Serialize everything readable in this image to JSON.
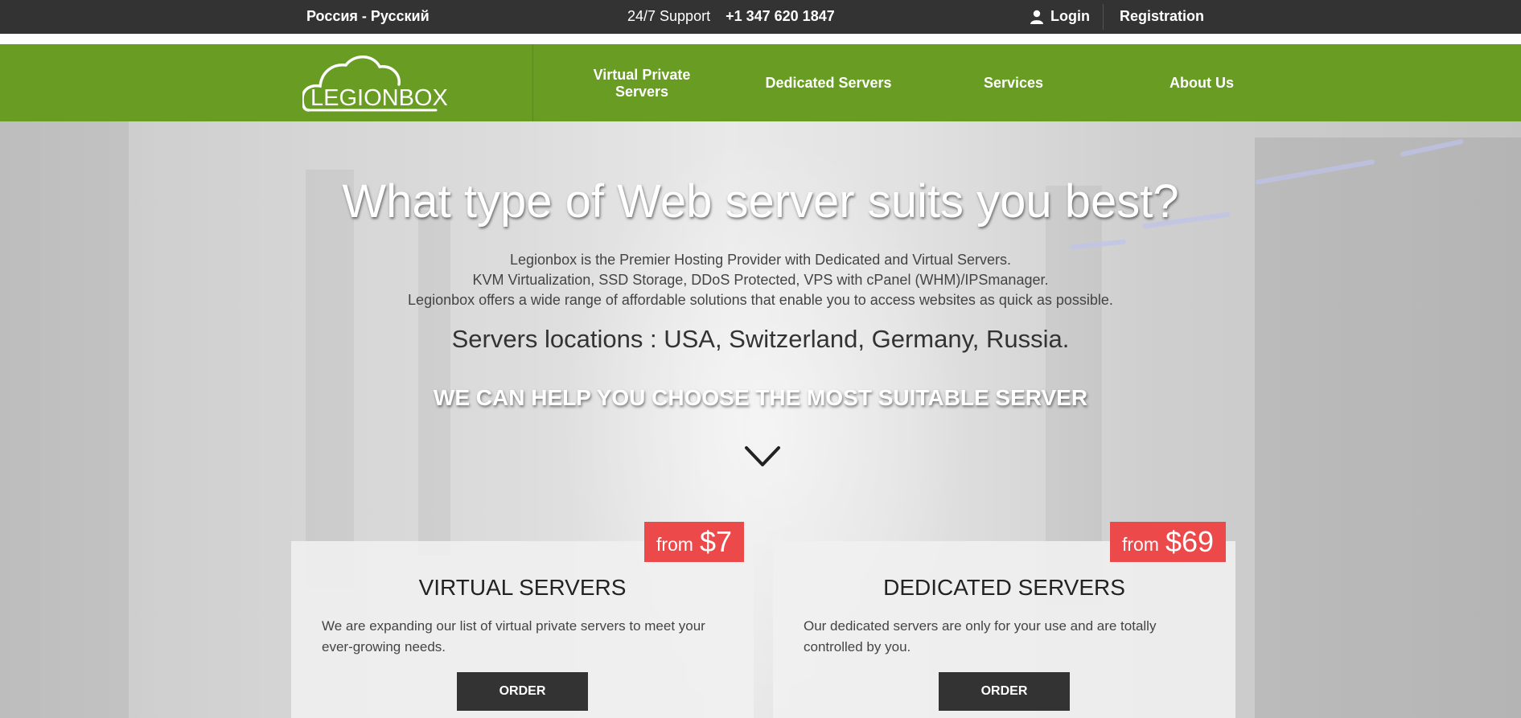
{
  "topbar": {
    "language": "Россия - Русский",
    "support_label": "24/7 Support",
    "phone": "+1 347 620 1847",
    "login": "Login",
    "registration": "Registration"
  },
  "nav": {
    "logo_text": "LEGIONBOX",
    "items": [
      {
        "label": "Virtual Private Servers"
      },
      {
        "label": "Dedicated Servers"
      },
      {
        "label": "Services"
      },
      {
        "label": "About Us"
      }
    ]
  },
  "hero": {
    "title": "What type of Web server suits you best?",
    "description": [
      "Legionbox is the Premier Hosting Provider with Dedicated and Virtual Servers.",
      "KVM Virtualization, SSD Storage, DDoS Protected, VPS with cPanel (WHM)/IPSmanager.",
      "Legionbox offers a wide range of affordable solutions that enable you to access websites as quick as possible."
    ],
    "locations": "Servers locations : USA, Switzerland, Germany, Russia.",
    "cta": "WE CAN HELP YOU CHOOSE THE MOST SUITABLE SERVER",
    "scroll_icon": "chevron-down-icon"
  },
  "cards": [
    {
      "price_prefix": "from",
      "price": "$7",
      "title": "VIRTUAL SERVERS",
      "description": "We are expanding our list of virtual private servers to meet your ever-growing needs.",
      "button": "ORDER"
    },
    {
      "price_prefix": "from",
      "price": "$69",
      "title": "DEDICATED SERVERS",
      "description": "Our dedicated servers are only for your use and are totally controlled by you.",
      "button": "ORDER"
    }
  ],
  "colors": {
    "topbar_bg": "#333333",
    "nav_green": "#689c22",
    "price_red": "#ec4a4a",
    "button_dark": "#333333"
  }
}
